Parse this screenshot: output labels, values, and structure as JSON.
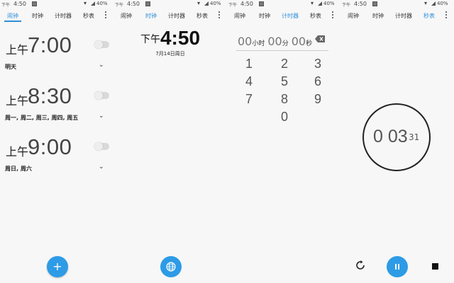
{
  "status_bar": {
    "carrier": "下午",
    "time": "4:50",
    "battery": "40%"
  },
  "tabs": [
    "闹钟",
    "时钟",
    "计时器",
    "秒表"
  ],
  "alarms": [
    {
      "ampm": "上午",
      "time": "7:00",
      "repeat": "明天",
      "enabled": false
    },
    {
      "ampm": "上午",
      "time": "8:30",
      "repeat": "周一, 周二, 周三, 周四, 周五",
      "enabled": false
    },
    {
      "ampm": "上午",
      "time": "9:00",
      "repeat": "周日, 周六",
      "enabled": false
    }
  ],
  "add_button": "+",
  "clock": {
    "ampm": "下午",
    "time": "4:50",
    "date": "7月14日周日"
  },
  "timer": {
    "hours": "00",
    "hours_unit": "小时",
    "minutes": "00",
    "minutes_unit": "分",
    "seconds": "00",
    "seconds_unit": "秒",
    "keys": [
      "1",
      "2",
      "3",
      "4",
      "5",
      "6",
      "7",
      "8",
      "9",
      "0"
    ]
  },
  "stopwatch": {
    "main": "0 03",
    "hundredths": "31"
  },
  "colors": {
    "accent": "#2d9be6",
    "active_tab": "#2f8fd6",
    "background": "#f7f7f7"
  }
}
